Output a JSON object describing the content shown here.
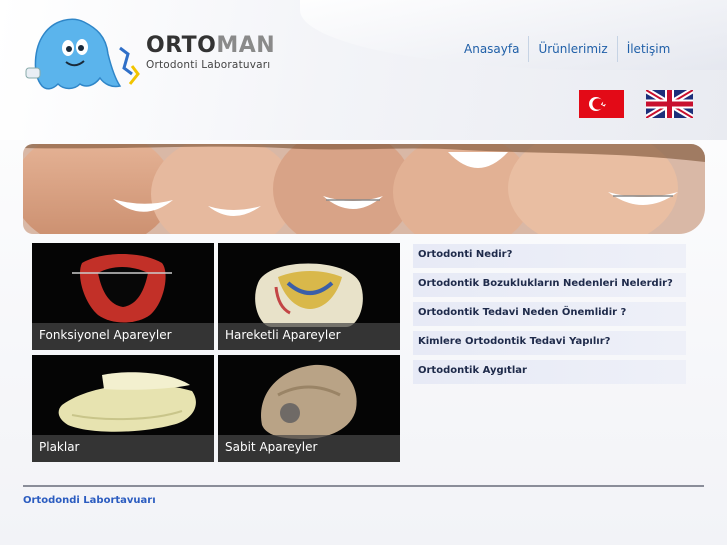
{
  "brand": {
    "name_part1": "ORTO",
    "name_part2": "MAN",
    "subtitle": "Ortodonti Laboratuvarı"
  },
  "nav": {
    "items": [
      "Anasayfa",
      "Ürünlerimiz",
      "İletişim"
    ]
  },
  "languages": [
    "turkish-flag",
    "uk-flag"
  ],
  "products": [
    {
      "caption": "Fonksiyonel Apareyler"
    },
    {
      "caption": "Hareketli Apareyler"
    },
    {
      "caption": "Plaklar"
    },
    {
      "caption": "Sabit Apareyler"
    }
  ],
  "questions": [
    "Ortodonti Nedir?",
    "Ortodontik Bozuklukların Nedenleri Nelerdir?",
    "Ortodontik Tedavi Neden Önemlidir ?",
    "Kimlere Ortodontik Tedavi Yapılır?",
    "Ortodontik Aygıtlar"
  ],
  "footer": {
    "text": "Ortodondi Labortavuarı"
  },
  "colors": {
    "nav_link": "#1f5fa8",
    "footer_link": "#2b5cc0",
    "question_bg": "#e7eaf6",
    "mascot": "#5bb4ec"
  }
}
